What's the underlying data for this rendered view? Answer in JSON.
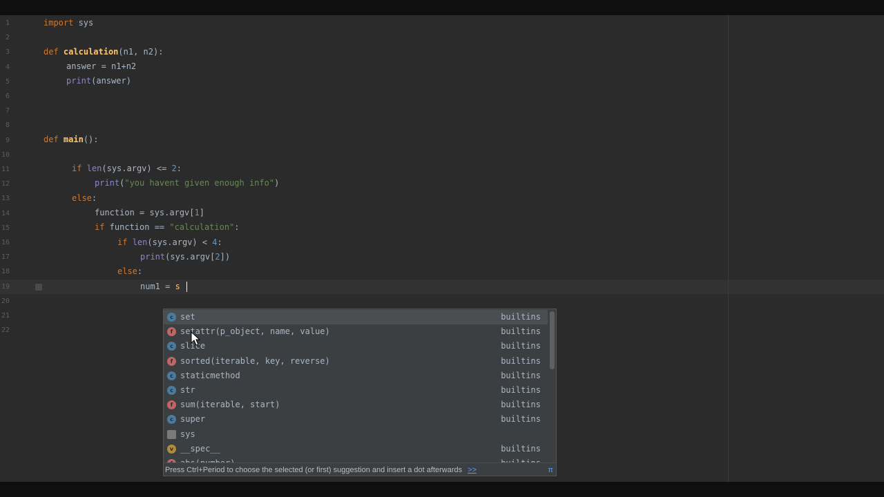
{
  "editor": {
    "line_numbers": [
      "1",
      "2",
      "3",
      "4",
      "5",
      "6",
      "7",
      "8",
      "9",
      "10",
      "11",
      "12",
      "13",
      "14",
      "15",
      "16",
      "17",
      "18",
      "19",
      "20",
      "21",
      "22"
    ],
    "code": {
      "l1_kw": "import",
      "l1_rest": " sys",
      "l3_kw": "def",
      "l3_fn": "calculation",
      "l3_rest": "(n1, n2):",
      "l4": "answer = n1+n2",
      "l5_bi": "print",
      "l5_rest": "(answer)",
      "l9_kw": "def",
      "l9_fn": "main",
      "l9_rest": "():",
      "l11_kw": "if",
      "l11_bi": "len",
      "l11_mid": "(sys.argv) <= ",
      "l11_num": "2",
      "l11_end": ":",
      "l12_bi": "print",
      "l12_open": "(",
      "l12_str": "\"you havent given enough info\"",
      "l12_close": ")",
      "l13_kw": "else",
      "l13_end": ":",
      "l14_a": "function = sys.argv[",
      "l14_num": "1",
      "l14_b": "]",
      "l15_kw": "if",
      "l15_mid": " function == ",
      "l15_str": "\"calculation\"",
      "l15_end": ":",
      "l16_kw": "if",
      "l16_bi": "len",
      "l16_mid": "(sys.argv) < ",
      "l16_num": "4",
      "l16_end": ":",
      "l17_bi": "print",
      "l17_a": "(sys.argv[",
      "l17_num": "2",
      "l17_b": "])",
      "l18_kw": "else",
      "l18_end": ":",
      "l19_a": "num1 = ",
      "l19_typed": "s"
    }
  },
  "completion": {
    "items": [
      {
        "kind": "c",
        "kind_glyph": "c",
        "label": "set",
        "source": "builtins"
      },
      {
        "kind": "f",
        "kind_glyph": "f",
        "label": "setattr(p_object, name, value)",
        "source": "builtins"
      },
      {
        "kind": "c",
        "kind_glyph": "c",
        "label": "slice",
        "source": "builtins"
      },
      {
        "kind": "f",
        "kind_glyph": "f",
        "label": "sorted(iterable, key, reverse)",
        "source": "builtins"
      },
      {
        "kind": "c",
        "kind_glyph": "c",
        "label": "staticmethod",
        "source": "builtins"
      },
      {
        "kind": "c",
        "kind_glyph": "c",
        "label": "str",
        "source": "builtins"
      },
      {
        "kind": "f",
        "kind_glyph": "f",
        "label": "sum(iterable, start)",
        "source": "builtins"
      },
      {
        "kind": "c",
        "kind_glyph": "c",
        "label": "super",
        "source": "builtins"
      },
      {
        "kind": "m",
        "kind_glyph": "",
        "label": "sys",
        "source": ""
      },
      {
        "kind": "v",
        "kind_glyph": "v",
        "label": "__spec__",
        "source": "builtins"
      },
      {
        "kind": "f",
        "kind_glyph": "f",
        "label": "abs(number)",
        "source": "builtins"
      }
    ],
    "selected_index": 0,
    "footer_hint": "Press Ctrl+Period to choose the selected (or first) suggestion and insert a dot afterwards",
    "footer_more": ">>",
    "footer_pi": "π"
  },
  "colors": {
    "editor_bg": "#2b2b2b",
    "keyword": "#cc7832",
    "function_name": "#ffc66d",
    "string": "#6a8759",
    "number": "#6897bb",
    "popup_bg": "#3c3f41"
  }
}
